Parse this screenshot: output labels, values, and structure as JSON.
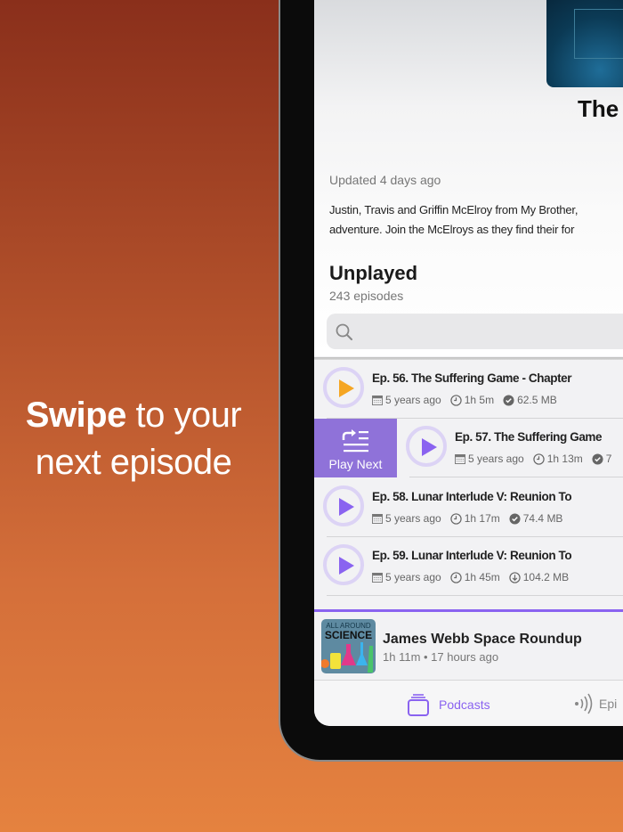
{
  "promo": {
    "bold": "Swipe",
    "rest_line1": " to your",
    "line2": "next episode"
  },
  "podcast": {
    "title": "The",
    "updated": "Updated 4 days ago",
    "description_lines": [
      "Justin, Travis and Griffin McElroy from My Brother,",
      "adventure. Join the McElroys as they find their for"
    ]
  },
  "section": {
    "title": "Unplayed",
    "count": "243 episodes"
  },
  "search": {
    "placeholder": ""
  },
  "swipe_action": {
    "label": "Play Next",
    "icon": "play-next-icon"
  },
  "episodes": [
    {
      "title": "Ep. 56. The Suffering Game - Chapter",
      "date": "5 years ago",
      "duration": "1h 5m",
      "size": "62.5 MB",
      "status": "downloaded",
      "play_color": "#f5a623"
    },
    {
      "title": "Ep. 57. The Suffering Game",
      "date": "5 years ago",
      "duration": "1h 13m",
      "size": "7",
      "status": "downloaded",
      "play_color": "#8a63f0"
    },
    {
      "title": "Ep. 58. Lunar Interlude V: Reunion To",
      "date": "5 years ago",
      "duration": "1h 17m",
      "size": "74.4 MB",
      "status": "downloaded",
      "play_color": "#8a63f0"
    },
    {
      "title": "Ep. 59. Lunar Interlude V: Reunion To",
      "date": "5 years ago",
      "duration": "1h 45m",
      "size": "104.2 MB",
      "status": "not-downloaded",
      "play_color": "#8a63f0"
    }
  ],
  "mini_player": {
    "cover_line1": "ALL AROUND",
    "cover_line2": "SCIENCE",
    "title": "James Webb Space Roundup",
    "subtitle": "1h 11m • 17 hours ago"
  },
  "tabs": [
    {
      "label": "Podcasts",
      "active": true
    },
    {
      "label": "Epi",
      "active": false
    }
  ],
  "colors": {
    "accent": "#8a63f0",
    "swipe": "#8f72d9"
  }
}
